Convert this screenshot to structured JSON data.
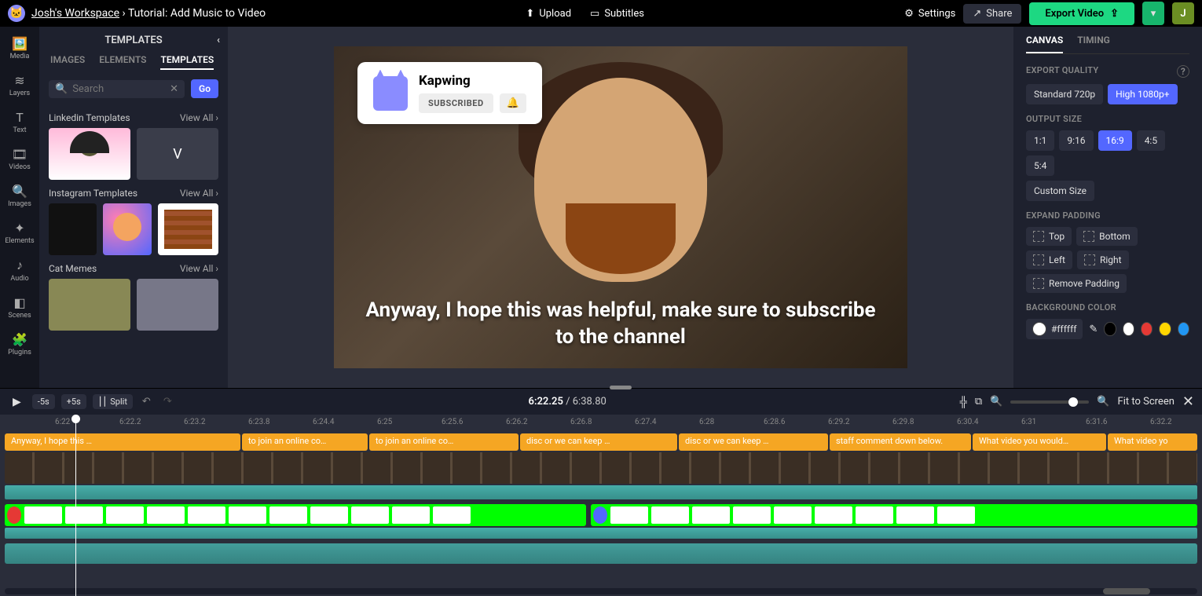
{
  "breadcrumb": {
    "workspace": "Josh's Workspace",
    "sep": "›",
    "project": "Tutorial: Add Music to Video"
  },
  "topbar": {
    "upload": "Upload",
    "subtitles": "Subtitles",
    "settings": "Settings",
    "share": "Share",
    "export": "Export Video",
    "avatar": "J"
  },
  "tools": [
    {
      "icon": "🖼️",
      "label": "Media"
    },
    {
      "icon": "≋",
      "label": "Layers"
    },
    {
      "icon": "T",
      "label": "Text"
    },
    {
      "icon": "🎞",
      "label": "Videos"
    },
    {
      "icon": "🔍",
      "label": "Images"
    },
    {
      "icon": "✦",
      "label": "Elements"
    },
    {
      "icon": "♪",
      "label": "Audio"
    },
    {
      "icon": "◧",
      "label": "Scenes"
    },
    {
      "icon": "🧩",
      "label": "Plugins"
    }
  ],
  "sidepanel": {
    "title": "TEMPLATES",
    "tabs": {
      "images": "IMAGES",
      "elements": "ELEMENTS",
      "templates": "TEMPLATES"
    },
    "search_placeholder": "Search",
    "go": "Go",
    "sections": [
      {
        "title": "Linkedin Templates",
        "viewall": "View All ›"
      },
      {
        "title": "Instagram Templates",
        "viewall": "View All ›"
      },
      {
        "title": "Cat Memes",
        "viewall": "View All ›"
      }
    ]
  },
  "preview": {
    "card_title": "Kapwing",
    "subscribed": "SUBSCRIBED",
    "caption": "Anyway, I hope this was helpful, make sure to subscribe to the channel"
  },
  "rightpanel": {
    "tabs": {
      "canvas": "CANVAS",
      "timing": "TIMING"
    },
    "export_quality": "EXPORT QUALITY",
    "quality_std": "Standard 720p",
    "quality_hi": "High 1080p+",
    "output_size": "OUTPUT SIZE",
    "ratios": [
      "1:1",
      "9:16",
      "16:9",
      "4:5",
      "5:4"
    ],
    "custom": "Custom Size",
    "expand": "EXPAND PADDING",
    "pad": {
      "top": "Top",
      "bottom": "Bottom",
      "left": "Left",
      "right": "Right",
      "remove": "Remove Padding"
    },
    "bg": "BACKGROUND COLOR",
    "bghex": "#ffffff"
  },
  "timeline_toolbar": {
    "back": "-5s",
    "fwd": "+5s",
    "split": "Split",
    "time": "6:22.25",
    "dur": "6:38.80",
    "fit": "Fit to Screen"
  },
  "ruler": [
    "6:22",
    "6:22.2",
    "6:23.2",
    "6:23.8",
    "6:24.4",
    "6:25",
    "6:25.6",
    "6:26.2",
    "6:26.8",
    "6:27.4",
    "6:28",
    "6:28.6",
    "6:29.2",
    "6:29.8",
    "6:30.4",
    "6:31",
    "6:31.6",
    "6:32.2"
  ],
  "subclips": [
    "Anyway, I hope this …",
    "to join an online co…",
    "to join an online co…",
    "disc or we can keep …",
    "disc or we can keep …",
    "staff comment down below.",
    "What video you would…",
    "What video yo"
  ]
}
